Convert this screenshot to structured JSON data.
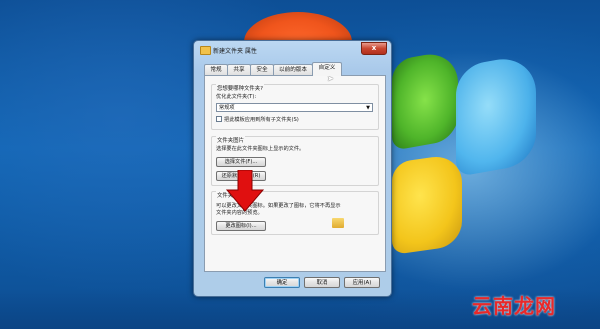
{
  "window": {
    "title": "新建文件夹 属性",
    "close_label": "x"
  },
  "tabs": [
    {
      "label": "常规"
    },
    {
      "label": "共享"
    },
    {
      "label": "安全"
    },
    {
      "label": "以前的版本"
    },
    {
      "label": "自定义"
    }
  ],
  "customize": {
    "optimize_group_title": "您想要哪种文件夹?",
    "optimize_label": "优化此文件夹(T):",
    "optimize_selected": "常规项",
    "apply_subfolders_label": "把此模板应用到所有子文件夹(S)",
    "folder_pictures_title": "文件夹图片",
    "folder_pictures_desc": "选择要在此文件夹图标上显示的文件。",
    "choose_file_button": "选择文件(F)...",
    "restore_default_button": "还原默认图标(R)",
    "folder_icons_title": "文件夹图标",
    "folder_icons_desc_1": "可以更改文件夹图标。如果更改了图标，它将不再显示",
    "folder_icons_desc_2": "文件夹内容的预览。",
    "change_icon_button": "更改图标(I)..."
  },
  "footer": {
    "ok_label": "确定",
    "cancel_label": "取消",
    "apply_label": "应用(A)"
  },
  "watermark": "云南龙网",
  "colors": {
    "arrow": "#e01010",
    "watermark": "#e8292a",
    "close_button": "#c9462f"
  },
  "icons": [
    "folder-icon",
    "close-icon",
    "dropdown-arrow-icon",
    "red-down-arrow-icon",
    "mouse-cursor-icon"
  ]
}
